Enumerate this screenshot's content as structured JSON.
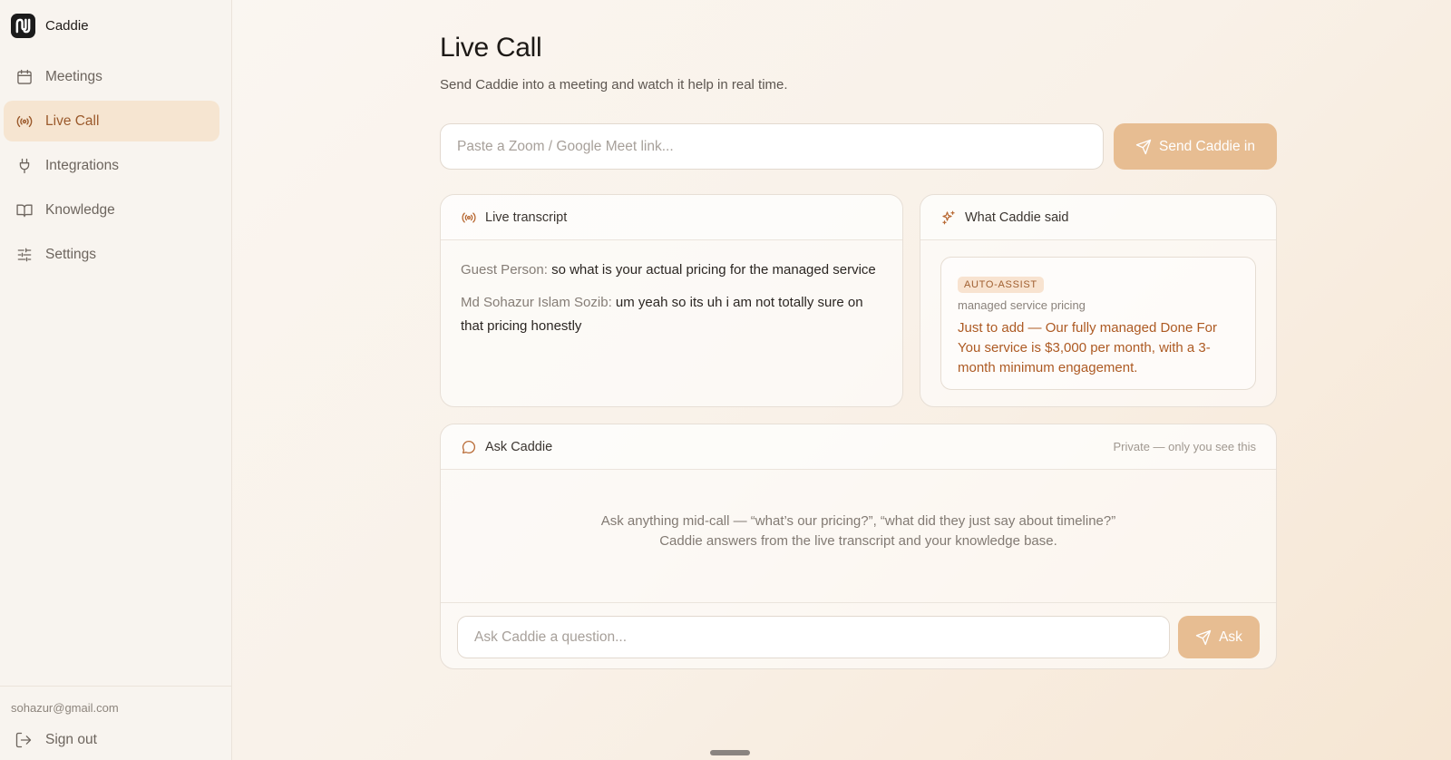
{
  "brand": {
    "name": "Caddie",
    "logo_icon": "caddie-logo-icon"
  },
  "sidebar": {
    "items": [
      {
        "label": "Meetings",
        "icon": "calendar-icon",
        "active": false
      },
      {
        "label": "Live Call",
        "icon": "broadcast-icon",
        "active": true
      },
      {
        "label": "Integrations",
        "icon": "plug-icon",
        "active": false
      },
      {
        "label": "Knowledge",
        "icon": "book-icon",
        "active": false
      },
      {
        "label": "Settings",
        "icon": "sliders-icon",
        "active": false
      }
    ],
    "user_email": "sohazur@gmail.com",
    "signout_label": "Sign out"
  },
  "page": {
    "title": "Live Call",
    "subtitle": "Send Caddie into a meeting and watch it help in real time."
  },
  "join": {
    "placeholder": "Paste a Zoom / Google Meet link...",
    "value": "",
    "button_label": "Send Caddie in"
  },
  "transcript": {
    "title": "Live transcript",
    "lines": [
      {
        "speaker": "Guest Person:",
        "text": "so what is your actual pricing for the managed service"
      },
      {
        "speaker": "Md Sohazur Islam Sozib:",
        "text": "um yeah so its uh i am not totally sure on that pricing honestly"
      }
    ]
  },
  "caddie_said": {
    "title": "What Caddie said",
    "badge": "AUTO-ASSIST",
    "topic": "managed service pricing",
    "message": "Just to add — Our fully managed Done For You service is $3,000 per month, with a 3-month minimum engagement."
  },
  "ask": {
    "title": "Ask Caddie",
    "private_note": "Private — only you see this",
    "hint_line1": "Ask anything mid-call — “what’s our pricing?”, “what did they just say about timeline?”",
    "hint_line2": "Caddie answers from the live transcript and your knowledge base.",
    "placeholder": "Ask Caddie a question...",
    "value": "",
    "button_label": "Ask"
  },
  "colors": {
    "accent": "#e7bd92",
    "accent_text": "#9b5a2c",
    "assist_text": "#ad5a23",
    "active_nav_bg": "#f6e5d1"
  }
}
